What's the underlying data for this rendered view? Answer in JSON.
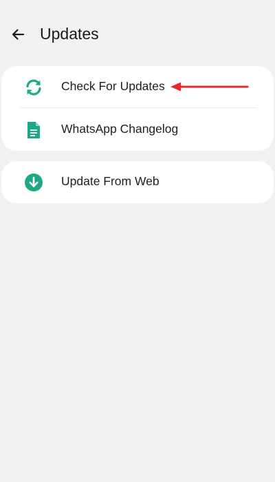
{
  "header": {
    "title": "Updates",
    "back_icon": "arrow-left-icon"
  },
  "menu": {
    "items": [
      {
        "label": "Check For Updates",
        "icon": "refresh-icon"
      },
      {
        "label": "WhatsApp Changelog",
        "icon": "document-icon"
      },
      {
        "label": "Update From Web",
        "icon": "download-circle-icon"
      }
    ]
  },
  "colors": {
    "accent": "#1fa885",
    "annotation_arrow": "#e8262c",
    "background": "#f1f1f1",
    "card": "#ffffff"
  }
}
